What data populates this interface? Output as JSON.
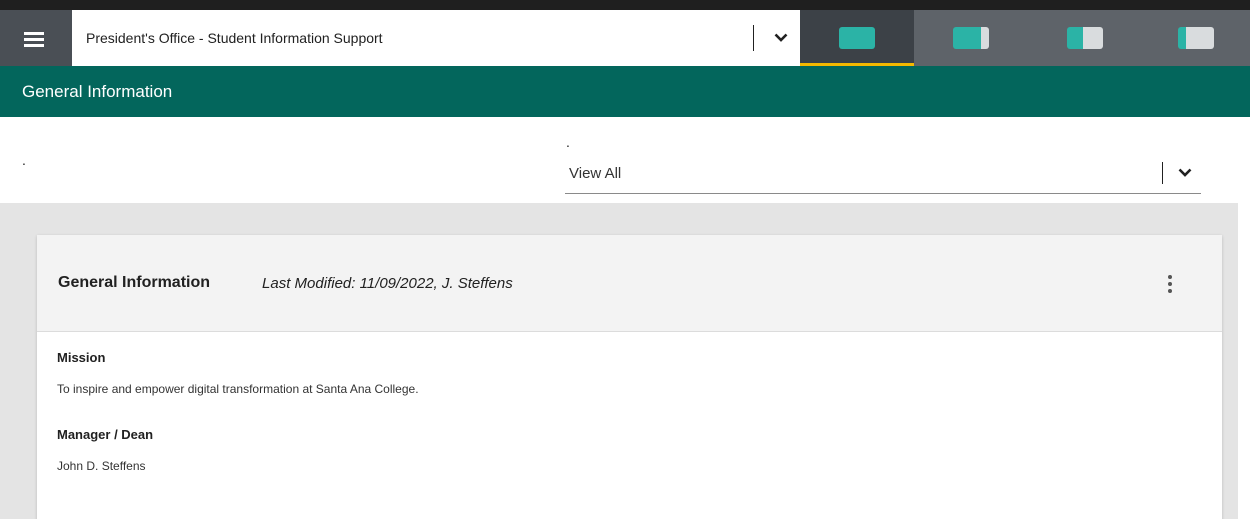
{
  "header": {
    "unit_select_value": "President's Office - Student Information Support",
    "layout_tabs": [
      {
        "name": "layout-full",
        "active": true
      },
      {
        "name": "layout-wide"
      },
      {
        "name": "layout-split"
      },
      {
        "name": "layout-narrow"
      }
    ],
    "colors": {
      "topbar": "#4a4f55",
      "accent": "#f5b800",
      "teal": "#2bb3a6"
    }
  },
  "titlebar": {
    "title": "General Information",
    "color": "#03665c"
  },
  "filter": {
    "left_label": ".",
    "select_label": ".",
    "select_value": "View All"
  },
  "card": {
    "title": "General Information",
    "last_modified": "Last Modified: 11/09/2022, J. Steffens",
    "fields": [
      {
        "label": "Mission",
        "value": "To inspire and empower digital transformation at Santa Ana College."
      },
      {
        "label": "Manager / Dean",
        "value": "John D. Steffens"
      }
    ]
  }
}
